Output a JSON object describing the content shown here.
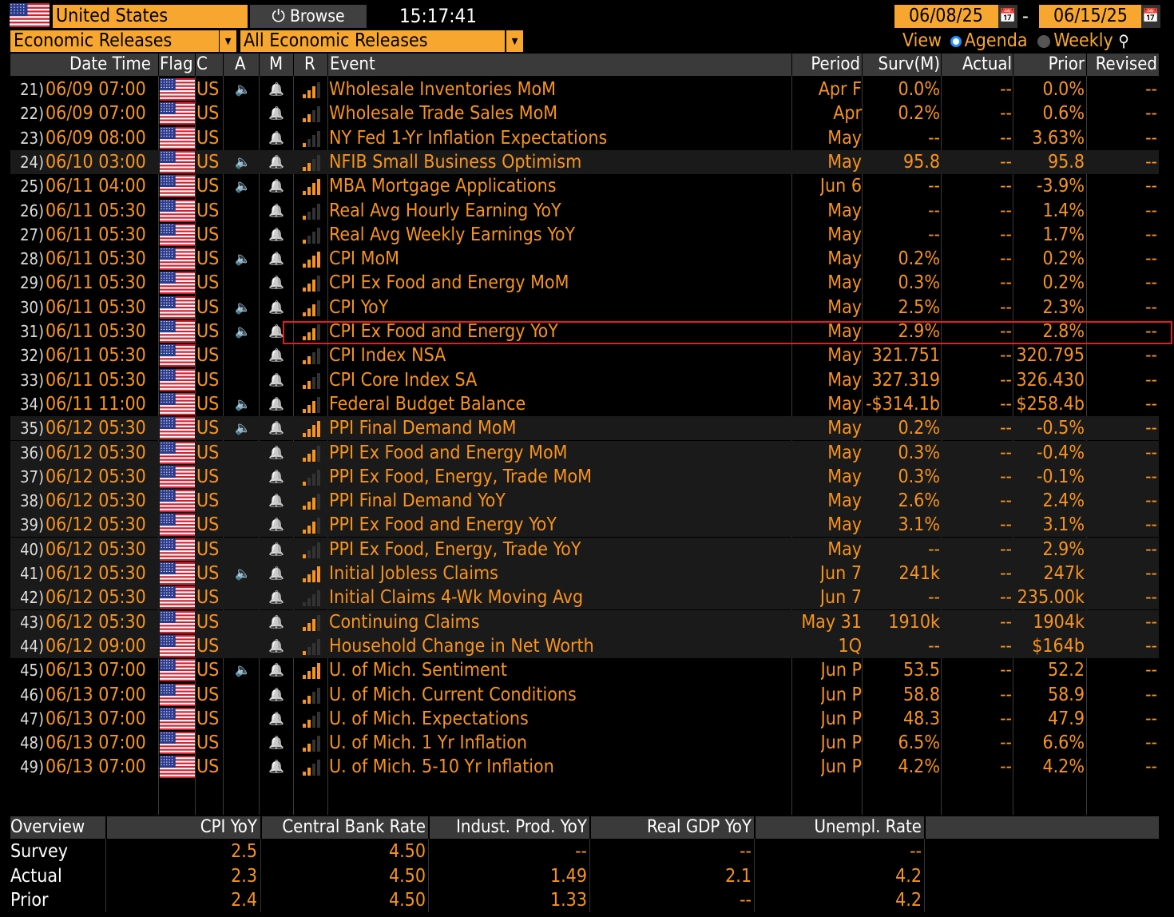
{
  "top": {
    "country": "United States",
    "browse": "Browse",
    "time": "15:17:41",
    "start_date": "06/08/25",
    "date_separator": "-",
    "end_date": "06/15/25",
    "calendar_glyph": "📅"
  },
  "filters": {
    "category": "Economic Releases",
    "subcategory": "All Economic Releases",
    "view_label": "View",
    "agenda": "Agenda",
    "weekly": "Weekly",
    "view_selected": "Agenda"
  },
  "columns": {
    "datetime": "Date Time",
    "flag": "Flag",
    "country": "C",
    "alert": "A",
    "market": "M",
    "relevance": "R",
    "event": "Event",
    "period": "Period",
    "survey": "Surv(M)",
    "actual": "Actual",
    "prior": "Prior",
    "revised": "Revised"
  },
  "colors": {
    "accent": "#f7a72f",
    "text_orange": "#f7941d",
    "highlight": "#e0201a"
  },
  "rows": [
    {
      "n": "21)",
      "dt": "06/09 07:00",
      "c": "US",
      "alert": true,
      "rel": 3,
      "event": "Wholesale Inventories MoM",
      "period": "Apr F",
      "surv": "0.0%",
      "actual": "--",
      "prior": "0.0%",
      "revised": "--"
    },
    {
      "n": "22)",
      "dt": "06/09 07:00",
      "c": "US",
      "alert": false,
      "rel": 2,
      "event": "Wholesale Trade Sales MoM",
      "period": "Apr",
      "surv": "0.2%",
      "actual": "--",
      "prior": "0.6%",
      "revised": "--"
    },
    {
      "n": "23)",
      "dt": "06/09 08:00",
      "c": "US",
      "alert": false,
      "rel": 1,
      "event": "NY Fed 1-Yr Inflation Expectations",
      "period": "May",
      "surv": "--",
      "actual": "--",
      "prior": "3.63%",
      "revised": "--"
    },
    {
      "n": "24)",
      "dt": "06/10 03:00",
      "c": "US",
      "alert": true,
      "rel": 2,
      "event": "NFIB Small Business Optimism",
      "period": "May",
      "surv": "95.8",
      "actual": "--",
      "prior": "95.8",
      "revised": "--"
    },
    {
      "n": "25)",
      "dt": "06/11 04:00",
      "c": "US",
      "alert": true,
      "rel": 4,
      "event": "MBA Mortgage Applications",
      "period": "Jun 6",
      "surv": "--",
      "actual": "--",
      "prior": "-3.9%",
      "revised": "--"
    },
    {
      "n": "26)",
      "dt": "06/11 05:30",
      "c": "US",
      "alert": false,
      "rel": 1,
      "event": "Real Avg Hourly Earning YoY",
      "period": "May",
      "surv": "--",
      "actual": "--",
      "prior": "1.4%",
      "revised": "--"
    },
    {
      "n": "27)",
      "dt": "06/11 05:30",
      "c": "US",
      "alert": false,
      "rel": 1,
      "event": "Real Avg Weekly Earnings YoY",
      "period": "May",
      "surv": "--",
      "actual": "--",
      "prior": "1.7%",
      "revised": "--"
    },
    {
      "n": "28)",
      "dt": "06/11 05:30",
      "c": "US",
      "alert": true,
      "rel": 4,
      "event": "CPI MoM",
      "period": "May",
      "surv": "0.2%",
      "actual": "--",
      "prior": "0.2%",
      "revised": "--"
    },
    {
      "n": "29)",
      "dt": "06/11 05:30",
      "c": "US",
      "alert": false,
      "rel": 3,
      "event": "CPI Ex Food and Energy MoM",
      "period": "May",
      "surv": "0.3%",
      "actual": "--",
      "prior": "0.2%",
      "revised": "--"
    },
    {
      "n": "30)",
      "dt": "06/11 05:30",
      "c": "US",
      "alert": true,
      "rel": 3,
      "event": "CPI YoY",
      "period": "May",
      "surv": "2.5%",
      "actual": "--",
      "prior": "2.3%",
      "revised": "--"
    },
    {
      "n": "31)",
      "dt": "06/11 05:30",
      "c": "US",
      "alert": true,
      "rel": 3,
      "event": "CPI Ex Food and Energy YoY",
      "period": "May",
      "surv": "2.9%",
      "actual": "--",
      "prior": "2.8%",
      "revised": "--"
    },
    {
      "n": "32)",
      "dt": "06/11 05:30",
      "c": "US",
      "alert": false,
      "rel": 2,
      "event": "CPI Index NSA",
      "period": "May",
      "surv": "321.751",
      "actual": "--",
      "prior": "320.795",
      "revised": "--"
    },
    {
      "n": "33)",
      "dt": "06/11 05:30",
      "c": "US",
      "alert": false,
      "rel": 2,
      "event": "CPI Core Index SA",
      "period": "May",
      "surv": "327.319",
      "actual": "--",
      "prior": "326.430",
      "revised": "--"
    },
    {
      "n": "34)",
      "dt": "06/11 11:00",
      "c": "US",
      "alert": true,
      "rel": 3,
      "event": "Federal Budget Balance",
      "period": "May",
      "surv": "-$314.1b",
      "actual": "--",
      "prior": "$258.4b",
      "revised": "--"
    },
    {
      "n": "35)",
      "dt": "06/12 05:30",
      "c": "US",
      "alert": true,
      "rel": 4,
      "event": "PPI Final Demand MoM",
      "period": "May",
      "surv": "0.2%",
      "actual": "--",
      "prior": "-0.5%",
      "revised": "--"
    },
    {
      "n": "36)",
      "dt": "06/12 05:30",
      "c": "US",
      "alert": false,
      "rel": 3,
      "event": "PPI Ex Food and Energy MoM",
      "period": "May",
      "surv": "0.3%",
      "actual": "--",
      "prior": "-0.4%",
      "revised": "--"
    },
    {
      "n": "37)",
      "dt": "06/12 05:30",
      "c": "US",
      "alert": false,
      "rel": 1,
      "event": "PPI Ex Food, Energy, Trade MoM",
      "period": "May",
      "surv": "0.3%",
      "actual": "--",
      "prior": "-0.1%",
      "revised": "--"
    },
    {
      "n": "38)",
      "dt": "06/12 05:30",
      "c": "US",
      "alert": false,
      "rel": 3,
      "event": "PPI Final Demand YoY",
      "period": "May",
      "surv": "2.6%",
      "actual": "--",
      "prior": "2.4%",
      "revised": "--"
    },
    {
      "n": "39)",
      "dt": "06/12 05:30",
      "c": "US",
      "alert": false,
      "rel": 3,
      "event": "PPI Ex Food and Energy YoY",
      "period": "May",
      "surv": "3.1%",
      "actual": "--",
      "prior": "3.1%",
      "revised": "--"
    },
    {
      "n": "40)",
      "dt": "06/12 05:30",
      "c": "US",
      "alert": false,
      "rel": 1,
      "event": "PPI Ex Food, Energy, Trade YoY",
      "period": "May",
      "surv": "--",
      "actual": "--",
      "prior": "2.9%",
      "revised": "--"
    },
    {
      "n": "41)",
      "dt": "06/12 05:30",
      "c": "US",
      "alert": true,
      "rel": 4,
      "event": "Initial Jobless Claims",
      "period": "Jun 7",
      "surv": "241k",
      "actual": "--",
      "prior": "247k",
      "revised": "--"
    },
    {
      "n": "42)",
      "dt": "06/12 05:30",
      "c": "US",
      "alert": false,
      "rel": 0,
      "event": "Initial Claims 4-Wk Moving Avg",
      "period": "Jun 7",
      "surv": "--",
      "actual": "--",
      "prior": "235.00k",
      "revised": "--"
    },
    {
      "n": "43)",
      "dt": "06/12 05:30",
      "c": "US",
      "alert": false,
      "rel": 3,
      "event": "Continuing Claims",
      "period": "May 31",
      "surv": "1910k",
      "actual": "--",
      "prior": "1904k",
      "revised": "--"
    },
    {
      "n": "44)",
      "dt": "06/12 09:00",
      "c": "US",
      "alert": false,
      "rel": 1,
      "event": "Household Change in Net Worth",
      "period": "1Q",
      "surv": "--",
      "actual": "--",
      "prior": "$164b",
      "revised": "--"
    },
    {
      "n": "45)",
      "dt": "06/13 07:00",
      "c": "US",
      "alert": true,
      "rel": 4,
      "event": "U. of Mich. Sentiment",
      "period": "Jun P",
      "surv": "53.5",
      "actual": "--",
      "prior": "52.2",
      "revised": "--"
    },
    {
      "n": "46)",
      "dt": "06/13 07:00",
      "c": "US",
      "alert": false,
      "rel": 2,
      "event": "U. of Mich. Current Conditions",
      "period": "Jun P",
      "surv": "58.8",
      "actual": "--",
      "prior": "58.9",
      "revised": "--"
    },
    {
      "n": "47)",
      "dt": "06/13 07:00",
      "c": "US",
      "alert": false,
      "rel": 2,
      "event": "U. of Mich. Expectations",
      "period": "Jun P",
      "surv": "48.3",
      "actual": "--",
      "prior": "47.9",
      "revised": "--"
    },
    {
      "n": "48)",
      "dt": "06/13 07:00",
      "c": "US",
      "alert": false,
      "rel": 2,
      "event": "U. of Mich. 1 Yr Inflation",
      "period": "Jun P",
      "surv": "6.5%",
      "actual": "--",
      "prior": "6.6%",
      "revised": "--"
    },
    {
      "n": "49)",
      "dt": "06/13 07:00",
      "c": "US",
      "alert": false,
      "rel": 2,
      "event": "U. of Mich. 5-10 Yr Inflation",
      "period": "Jun P",
      "surv": "4.2%",
      "actual": "--",
      "prior": "4.2%",
      "revised": "--"
    }
  ],
  "overview": {
    "title": "Overview",
    "headers": [
      "CPI YoY",
      "Central Bank Rate",
      "Indust. Prod. YoY",
      "Real GDP YoY",
      "Unempl. Rate"
    ],
    "rows": [
      {
        "label": "Survey",
        "values": [
          "2.5",
          "4.50",
          "--",
          "--",
          "--"
        ]
      },
      {
        "label": "Actual",
        "values": [
          "2.3",
          "4.50",
          "1.49",
          "2.1",
          "4.2"
        ]
      },
      {
        "label": "Prior",
        "values": [
          "2.4",
          "4.50",
          "1.33",
          "--",
          "4.2"
        ]
      }
    ]
  }
}
